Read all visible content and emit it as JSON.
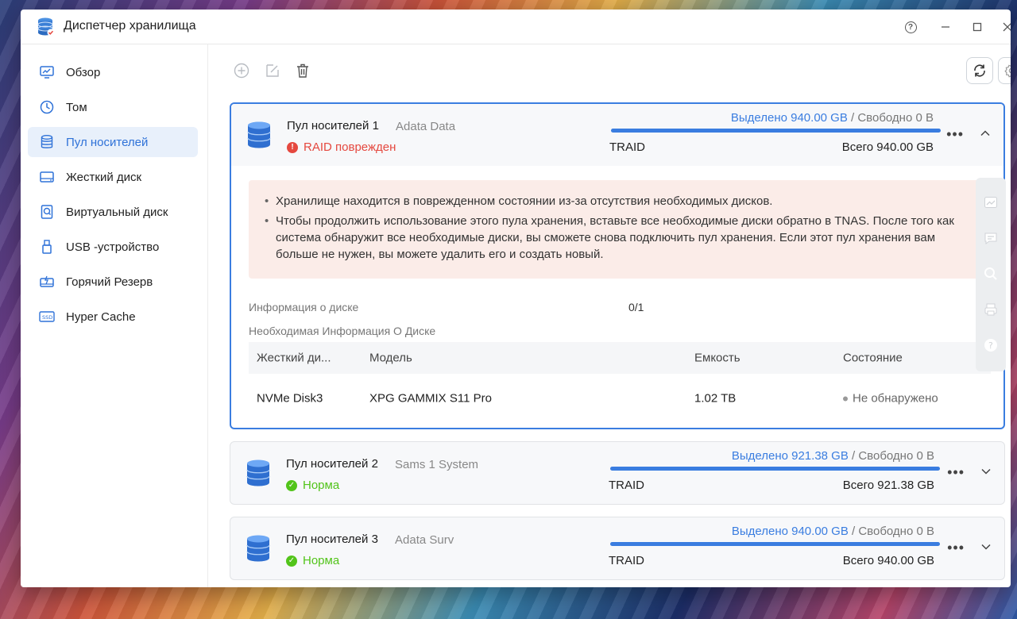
{
  "window": {
    "title": "Диспетчер хранилища"
  },
  "sidebar": {
    "items": [
      {
        "label": "Обзор",
        "icon": "monitor-chart-icon"
      },
      {
        "label": "Том",
        "icon": "volume-icon"
      },
      {
        "label": "Пул носителей",
        "icon": "database-icon"
      },
      {
        "label": "Жесткий диск",
        "icon": "hard-disk-icon"
      },
      {
        "label": "Виртуальный диск",
        "icon": "virtual-disk-icon"
      },
      {
        "label": "USB -устройство",
        "icon": "usb-icon"
      },
      {
        "label": "Горячий Резерв",
        "icon": "hot-spare-icon"
      },
      {
        "label": "Hyper Cache",
        "icon": "ssd-icon"
      }
    ],
    "active_index": 2
  },
  "pools": [
    {
      "name": "Пул носителей 1",
      "sub": "Adata Data",
      "status": "RAID поврежден",
      "status_type": "error",
      "alloc_label": "Выделено",
      "alloc_value": "940.00 GB",
      "free_label": "/ Свободно",
      "free_value": "0 B",
      "raid": "TRAID",
      "total": "Всего 940.00 GB",
      "used_fraction": 1.0
    },
    {
      "name": "Пул носителей 2",
      "sub": "Sams 1 System",
      "status": "Норма",
      "status_type": "ok",
      "alloc_label": "Выделено",
      "alloc_value": "921.38 GB",
      "free_label": "/ Свободно",
      "free_value": "0 B",
      "raid": "TRAID",
      "total": "Всего 921.38 GB",
      "used_fraction": 1.0
    },
    {
      "name": "Пул носителей 3",
      "sub": "Adata Surv",
      "status": "Норма",
      "status_type": "ok",
      "alloc_label": "Выделено",
      "alloc_value": "940.00 GB",
      "free_label": "/ Свободно",
      "free_value": "0 B",
      "raid": "TRAID",
      "total": "Всего 940.00 GB",
      "used_fraction": 1.0
    }
  ],
  "alert": {
    "line1": "Хранилище находится в поврежденном состоянии из-за отсутствия необходимых дисков.",
    "line2": "Чтобы продолжить использование этого пула хранения, вставьте все необходимые диски обратно в TNAS. После того как система обнаружит все необходимые диски, вы сможете снова подключить пул хранения. Если этот пул хранения вам больше не нужен, вы можете удалить его и создать новый."
  },
  "disk_info": {
    "label": "Информация о диске",
    "value": "0/1",
    "required_label": "Необходимая Информация О Диске"
  },
  "disk_table": {
    "headers": [
      "Жесткий ди...",
      "Модель",
      "Емкость",
      "Состояние"
    ],
    "rows": [
      {
        "disk": "NVMe Disk3",
        "model": "XPG GAMMIX S11 Pro",
        "capacity": "1.02 TB",
        "state": "Не обнаружено"
      }
    ]
  },
  "colors": {
    "accent": "#3a7de0",
    "error": "#e5483f",
    "ok": "#52c41a",
    "alert_bg": "#fbece8"
  }
}
